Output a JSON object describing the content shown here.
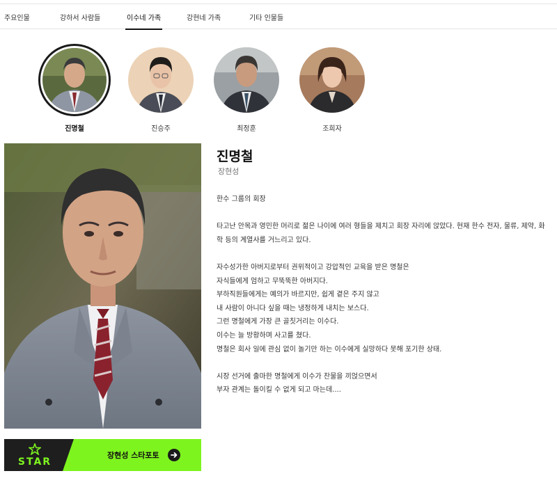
{
  "tabs": [
    {
      "label": "주요인물"
    },
    {
      "label": "강하서 사람들"
    },
    {
      "label": "이수네 가족"
    },
    {
      "label": "강현네 가족"
    },
    {
      "label": "기타 인물들"
    }
  ],
  "active_tab": "이수네 가족",
  "cast": [
    {
      "name": "진명철",
      "selected": true
    },
    {
      "name": "진승주"
    },
    {
      "name": "최정훈"
    },
    {
      "name": "조희자"
    }
  ],
  "profile": {
    "character": "진명철",
    "actor": "장현성",
    "description": [
      "한수 그룹의 회장",
      "",
      "타고난 안목과 영민한 머리로 젊은 나이에 여러 형들을 제치고 회장 자리에 앉았다. 현재 한수 전자, 물류, 제약, 화",
      "학 등의 계열사를 거느리고 있다.",
      "",
      "자수성가한 아버지로부터 권위적이고 강압적인 교육을 받은 명철은",
      "자식들에게 엄하고 무뚝뚝한 아버지다.",
      "부하직원들에게는 예의가 바르지만, 쉽게 곁은 주지 않고",
      "내 사람이 아니다 싶을 때는 냉정하게 내치는 보스다.",
      "그런 명철에게 가장 큰 골칫거리는 이수다.",
      "이수는 늘 방황하며 사고를 쳤다.",
      "명철은 회사 일에 관심 없이 놀기만 하는 이수에게 실망하다 못해 포기한 상태.",
      "",
      "시장 선거에 출마한 명철에게 이수가 찬물을 끼얹으면서",
      "부자 관계는 돌이킬 수 없게 되고 마는데...."
    ]
  },
  "banner": {
    "logo_text": "STAR",
    "label": "장현성 스타포토",
    "icon": "arrow-right-icon",
    "colors": {
      "accent": "#7ef41f",
      "dark": "#1e1e1e"
    }
  }
}
